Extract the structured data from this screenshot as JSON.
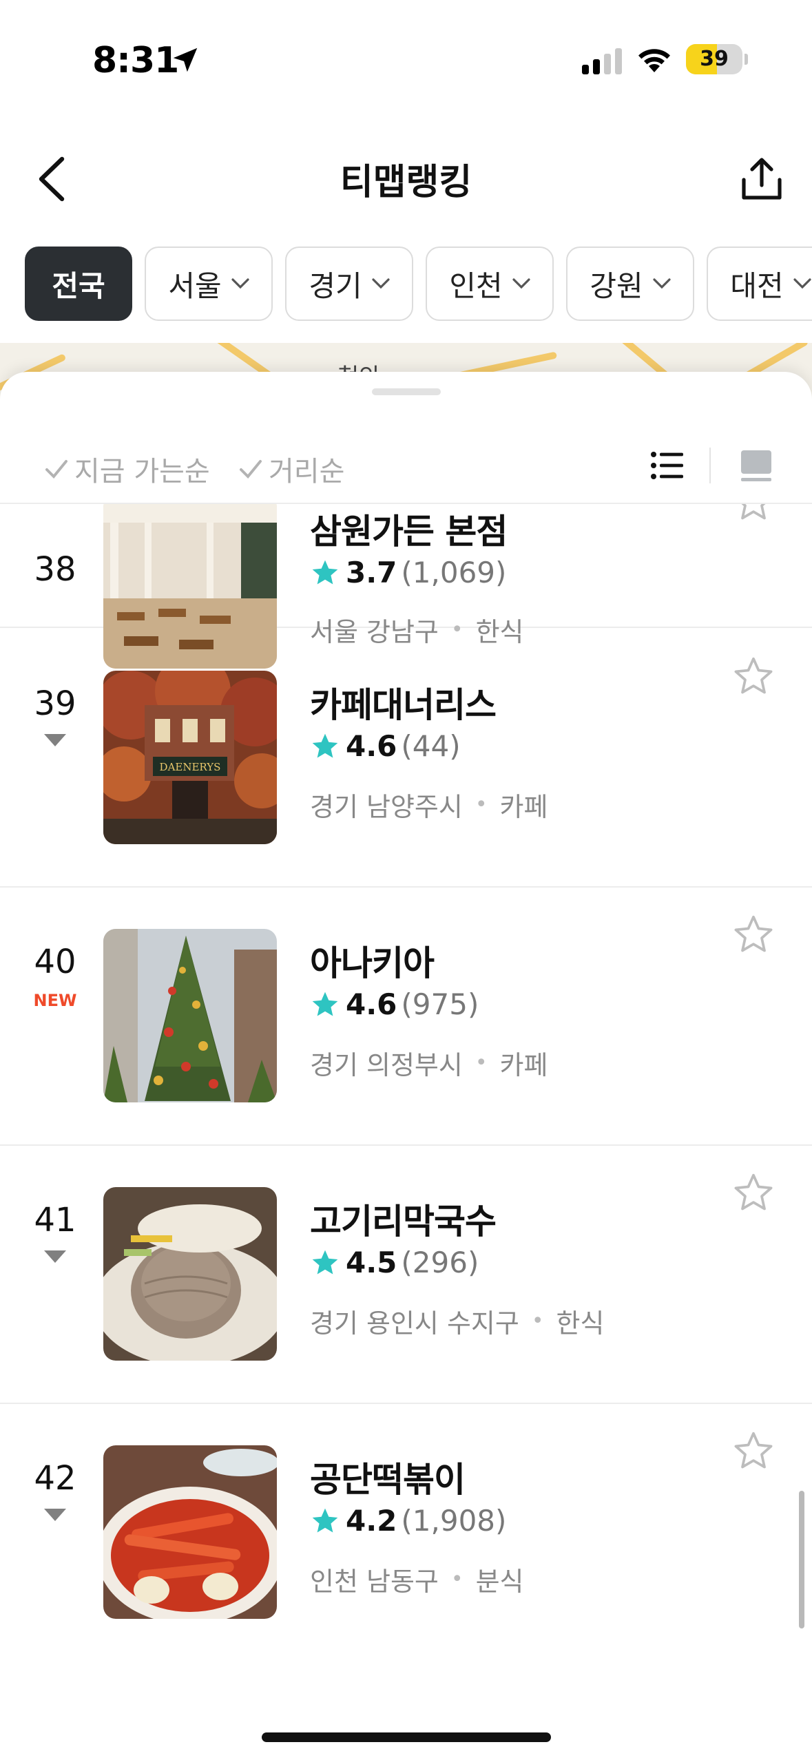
{
  "status_bar": {
    "time": "8:31",
    "battery": "39",
    "icons": [
      "location-arrow-icon",
      "signal-icon",
      "wifi-icon",
      "battery-icon"
    ]
  },
  "header": {
    "title": "티맵랭킹",
    "back_icon": "chevron-left-icon",
    "share_icon": "share-icon"
  },
  "regions": [
    {
      "label": "전국",
      "active": true,
      "dropdown": false
    },
    {
      "label": "서울",
      "active": false,
      "dropdown": true
    },
    {
      "label": "경기",
      "active": false,
      "dropdown": true
    },
    {
      "label": "인천",
      "active": false,
      "dropdown": true
    },
    {
      "label": "강원",
      "active": false,
      "dropdown": true
    },
    {
      "label": "대전",
      "active": false,
      "dropdown": true
    }
  ],
  "map": {
    "visible_label": "청안"
  },
  "sort": {
    "options": [
      "지금 가는순",
      "거리순"
    ],
    "view_icons": [
      "list-view-icon",
      "card-view-icon"
    ]
  },
  "items": [
    {
      "rank": "38",
      "change": "",
      "name": "삼원가든 본점",
      "rating": "3.7",
      "reviews": "(1,069)",
      "region": "서울 강남구",
      "category": "한식"
    },
    {
      "rank": "39",
      "change": "down",
      "name": "카페대너리스",
      "rating": "4.6",
      "reviews": "(44)",
      "region": "경기 남양주시",
      "category": "카페",
      "sign_text": "DAENERYS"
    },
    {
      "rank": "40",
      "change": "new",
      "new_label": "NEW",
      "name": "아나키아",
      "rating": "4.6",
      "reviews": "(975)",
      "region": "경기 의정부시",
      "category": "카페"
    },
    {
      "rank": "41",
      "change": "down",
      "name": "고기리막국수",
      "rating": "4.5",
      "reviews": "(296)",
      "region": "경기 용인시 수지구",
      "category": "한식"
    },
    {
      "rank": "42",
      "change": "down",
      "name": "공단떡볶이",
      "rating": "4.2",
      "reviews": "(1,908)",
      "region": "인천 남동구",
      "category": "분식"
    }
  ],
  "colors": {
    "accent_star": "#2ec4c1",
    "active_chip": "#2b2f33",
    "new_badge": "#ef4a2a",
    "battery": "#f7d31b"
  }
}
